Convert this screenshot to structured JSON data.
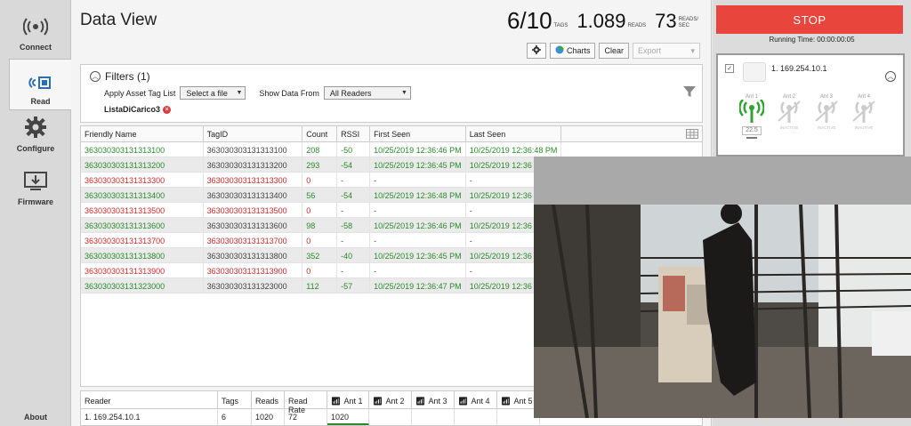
{
  "nav": {
    "connect": "Connect",
    "read": "Read",
    "configure": "Configure",
    "firmware": "Firmware",
    "about": "About"
  },
  "header": {
    "title": "Data View",
    "tags_count": "6/10",
    "tags_unit": "TAGS",
    "reads_count": "1.089",
    "reads_unit": "READS",
    "rate_count": "73",
    "rate_unit_1": "READS/",
    "rate_unit_2": "SEC"
  },
  "toolbar": {
    "charts": "Charts",
    "clear": "Clear",
    "export": "Export"
  },
  "filters": {
    "title": "Filters (1)",
    "apply_label": "Apply Asset Tag List",
    "select_file": "Select a file",
    "show_from_label": "Show Data From",
    "show_from_value": "All Readers",
    "active_filter": "ListaDiCarico3"
  },
  "table": {
    "headers": [
      "Friendly Name",
      "TagID",
      "Count",
      "RSSI",
      "First Seen",
      "Last Seen"
    ],
    "rows": [
      {
        "name": "363030303131313100",
        "tag": "363030303131313100",
        "count": "208",
        "rssi": "-50",
        "first": "10/25/2019 12:36:46 PM",
        "last": "10/25/2019 12:36:48 PM",
        "status": "green"
      },
      {
        "name": "363030303131313200",
        "tag": "363030303131313200",
        "count": "293",
        "rssi": "-54",
        "first": "10/25/2019 12:36:45 PM",
        "last": "10/25/2019 12:36",
        "status": "green"
      },
      {
        "name": "363030303131313300",
        "tag": "363030303131313300",
        "count": "0",
        "rssi": "-",
        "first": "-",
        "last": "-",
        "status": "red"
      },
      {
        "name": "363030303131313400",
        "tag": "363030303131313400",
        "count": "56",
        "rssi": "-54",
        "first": "10/25/2019 12:36:48 PM",
        "last": "10/25/2019 12:36",
        "status": "green"
      },
      {
        "name": "363030303131313500",
        "tag": "363030303131313500",
        "count": "0",
        "rssi": "-",
        "first": "-",
        "last": "-",
        "status": "red"
      },
      {
        "name": "363030303131313600",
        "tag": "363030303131313600",
        "count": "98",
        "rssi": "-58",
        "first": "10/25/2019 12:36:46 PM",
        "last": "10/25/2019 12:36",
        "status": "green"
      },
      {
        "name": "363030303131313700",
        "tag": "363030303131313700",
        "count": "0",
        "rssi": "-",
        "first": "-",
        "last": "-",
        "status": "red"
      },
      {
        "name": "363030303131313800",
        "tag": "363030303131313800",
        "count": "352",
        "rssi": "-40",
        "first": "10/25/2019 12:36:45 PM",
        "last": "10/25/2019 12:36",
        "status": "green"
      },
      {
        "name": "363030303131313900",
        "tag": "363030303131313900",
        "count": "0",
        "rssi": "-",
        "first": "-",
        "last": "-",
        "status": "red"
      },
      {
        "name": "363030303131323000",
        "tag": "363030303131323000",
        "count": "112",
        "rssi": "-57",
        "first": "10/25/2019 12:36:47 PM",
        "last": "10/25/2019 12:36",
        "status": "green"
      }
    ]
  },
  "reader_table": {
    "headers": [
      "Reader",
      "Tags",
      "Reads",
      "Read Rate",
      "Ant 1",
      "Ant 2",
      "Ant 3",
      "Ant 4",
      "Ant 5"
    ],
    "row": {
      "reader": "1. 169.254.10.1",
      "tags": "6",
      "reads": "1020",
      "rate": "72",
      "ant1": "1020"
    }
  },
  "right": {
    "stop": "STOP",
    "running": "Running Time: 00:00:00:05",
    "reader_ip": "1. 169.254.10.1",
    "antennas": [
      {
        "label": "Ant 1",
        "status": "",
        "value": "22.5",
        "active": true
      },
      {
        "label": "Ant 2",
        "status": "INACTIVE",
        "active": false
      },
      {
        "label": "Ant 3",
        "status": "INACTIVE",
        "active": false
      },
      {
        "label": "Ant 4",
        "status": "INACTIVE",
        "active": false
      }
    ]
  },
  "colors": {
    "accent_green": "#2a8a2a",
    "missing_red": "#d02a2a",
    "stop_button": "#e8463c"
  }
}
